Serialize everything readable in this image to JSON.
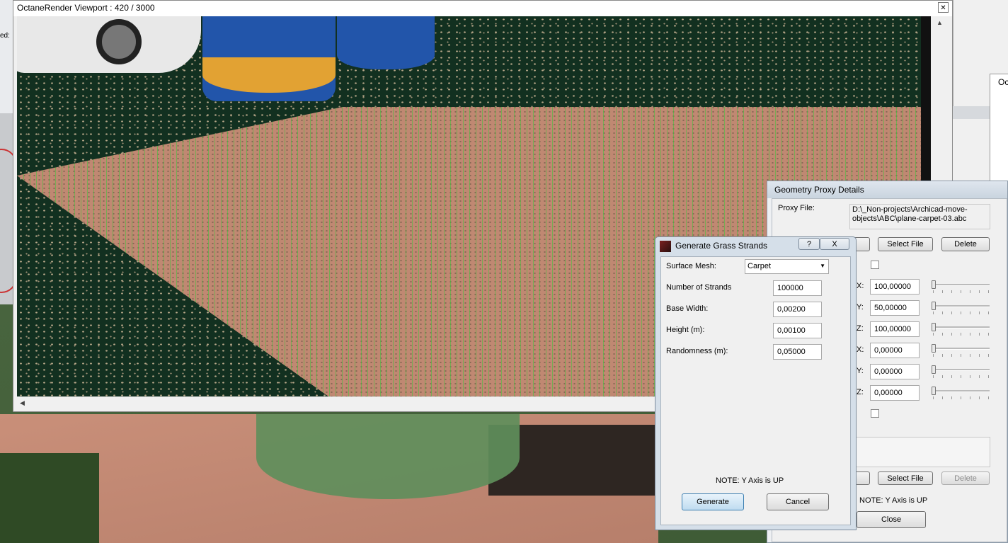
{
  "octane_window": {
    "title": "OctaneRender Viewport : 420  / 3000"
  },
  "left_strip": {
    "label": "ed:"
  },
  "oc_panel": {
    "title": "Oc"
  },
  "geometry_proxy": {
    "title": "Geometry Proxy Details",
    "proxy_file_label": "Proxy File:",
    "proxy_file_path": "D:\\_Non-projects\\Archicad-move-objects\\ABC\\plane-carpet-03.abc",
    "select_file_label": "Select File",
    "delete_label": "Delete",
    "rows": [
      {
        "axis": "X:",
        "value": "100,00000"
      },
      {
        "axis": "Y:",
        "value": "50,00000"
      },
      {
        "axis": "Z:",
        "value": "100,00000"
      },
      {
        "axis": "X:",
        "value": "0,00000"
      },
      {
        "axis": "Y:",
        "value": "0,00000"
      },
      {
        "axis": "Z:",
        "value": "0,00000"
      }
    ],
    "select_file_label_2": "Select File",
    "delete_label_2": "Delete",
    "note": "NOTE: Y Axis is UP",
    "close_label": "Close"
  },
  "grass_dialog": {
    "title": "Generate Grass Strands",
    "help_label": "?",
    "close_label": "X",
    "surface_mesh_label": "Surface Mesh:",
    "surface_mesh_value": "Carpet",
    "strands_label": "Number of Strands",
    "strands_value": "100000",
    "base_width_label": "Base Width:",
    "base_width_value": "0,00200",
    "height_label": "Height (m):",
    "height_value": "0,00100",
    "randomness_label": "Randomness (m):",
    "randomness_value": "0,05000",
    "note": "NOTE: Y Axis is UP",
    "generate_label": "Generate",
    "cancel_label": "Cancel"
  }
}
